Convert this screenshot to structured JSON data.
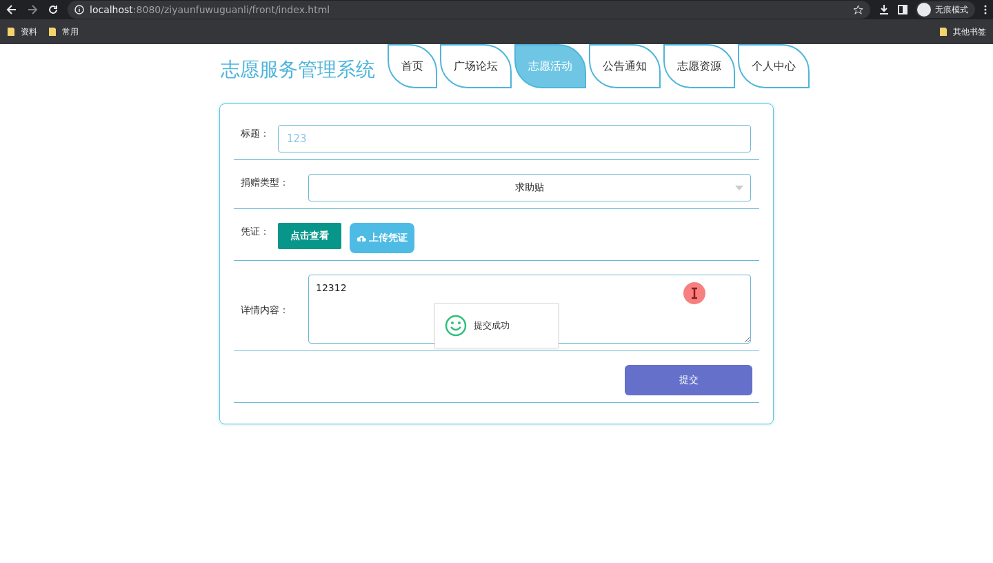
{
  "browser": {
    "url_host": "localhost",
    "url_path": ":8080/ziyaunfuwuguanli/front/index.html",
    "profile": "无痕模式",
    "bookmarks": [
      "资料",
      "常用"
    ],
    "other_bookmarks": "其他书签"
  },
  "site_title": "志愿服务管理系统",
  "nav": [
    {
      "label": "首页",
      "selected": false
    },
    {
      "label": "广场论坛",
      "selected": false
    },
    {
      "label": "志愿活动",
      "selected": true
    },
    {
      "label": "公告通知",
      "selected": false
    },
    {
      "label": "志愿资源",
      "selected": false
    },
    {
      "label": "个人中心",
      "selected": false
    }
  ],
  "form": {
    "title_label": "标题：",
    "title_value": "123",
    "type_label": "捐赠类型：",
    "type_value": "求助贴",
    "proof_label": "凭证：",
    "view_button": "点击查看",
    "upload_button": "上传凭证",
    "content_label": "详情内容：",
    "content_value": "12312",
    "submit_button": "提交"
  },
  "toast": {
    "message": "提交成功"
  }
}
